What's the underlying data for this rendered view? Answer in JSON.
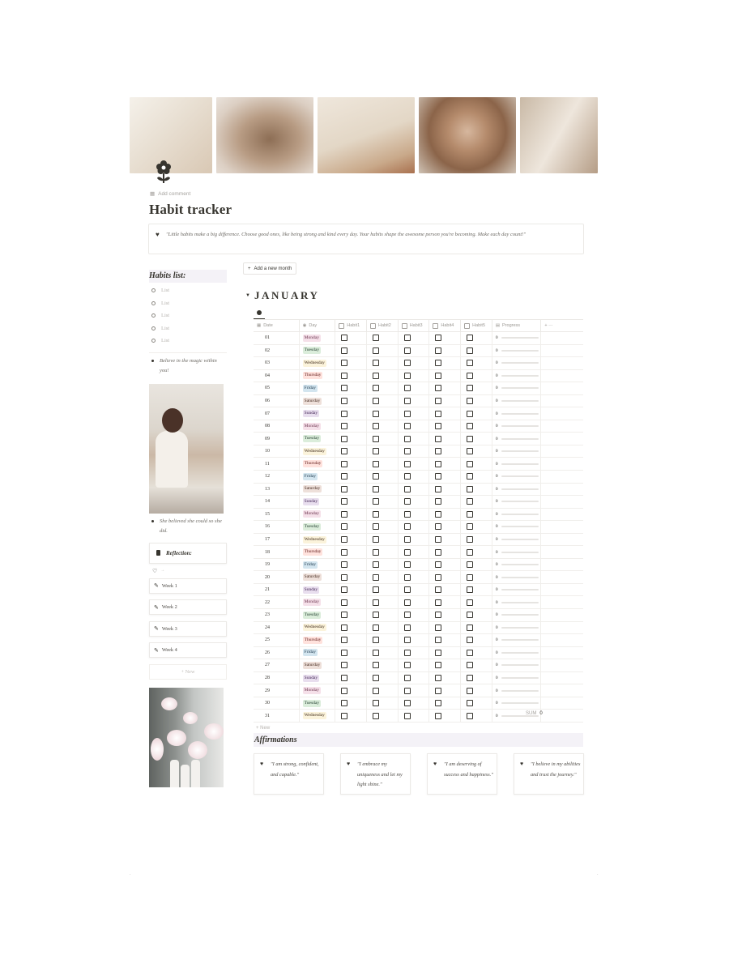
{
  "page": {
    "title": "Habit tracker",
    "add_comment": "Add comment",
    "quote": "\"Little habits make a big difference. Choose good ones, like being strong and kind every day. Your habits shape the awesome person you're becoming. Make each day count!\""
  },
  "sidebar": {
    "habits_heading": "Habits list:",
    "list_items": [
      "List",
      "List",
      "List",
      "List",
      "List"
    ],
    "quote1": "Believe in the magic within you!",
    "quote2": "She believed she could so she did.",
    "reflection_label": "Reflection:",
    "heart_row": "♥ →",
    "weeks": [
      "Week 1",
      "Week 2",
      "Week 3",
      "Week 4"
    ],
    "new_label": "+ New"
  },
  "month": {
    "add_month_label": "Add a new month",
    "name": "JANUARY"
  },
  "table": {
    "headers": {
      "date": "Date",
      "day": "Day",
      "habits": [
        "Habit1",
        "Habit2",
        "Habit3",
        "Habit4",
        "Habit5"
      ],
      "progress": "Progress",
      "add": "+  ···"
    },
    "day_colors": {
      "Monday": {
        "bg": "#f5e0e9",
        "fg": "#69314c"
      },
      "Tuesday": {
        "bg": "#dbeddb",
        "fg": "#1c3829"
      },
      "Wednesday": {
        "bg": "#fbf3db",
        "fg": "#402c1b"
      },
      "Thursday": {
        "bg": "#ffe2dd",
        "fg": "#5d1715"
      },
      "Friday": {
        "bg": "#d3e5ef",
        "fg": "#183347"
      },
      "Saturday": {
        "bg": "#eee0da",
        "fg": "#442a1e"
      },
      "Sunday": {
        "bg": "#e8deee",
        "fg": "#412454"
      }
    },
    "rows": [
      {
        "date": "01",
        "day": "Monday",
        "progress": "0"
      },
      {
        "date": "02",
        "day": "Tuesday",
        "progress": "0"
      },
      {
        "date": "03",
        "day": "Wednesday",
        "progress": "0"
      },
      {
        "date": "04",
        "day": "Thursday",
        "progress": "0"
      },
      {
        "date": "05",
        "day": "Friday",
        "progress": "0"
      },
      {
        "date": "06",
        "day": "Saturday",
        "progress": "0"
      },
      {
        "date": "07",
        "day": "Sunday",
        "progress": "0"
      },
      {
        "date": "08",
        "day": "Monday",
        "progress": "0"
      },
      {
        "date": "09",
        "day": "Tuesday",
        "progress": "0"
      },
      {
        "date": "10",
        "day": "Wednesday",
        "progress": "0"
      },
      {
        "date": "11",
        "day": "Thursday",
        "progress": "0"
      },
      {
        "date": "12",
        "day": "Friday",
        "progress": "0"
      },
      {
        "date": "13",
        "day": "Saturday",
        "progress": "0"
      },
      {
        "date": "14",
        "day": "Sunday",
        "progress": "0"
      },
      {
        "date": "15",
        "day": "Monday",
        "progress": "0"
      },
      {
        "date": "16",
        "day": "Tuesday",
        "progress": "0"
      },
      {
        "date": "17",
        "day": "Wednesday",
        "progress": "0"
      },
      {
        "date": "18",
        "day": "Thursday",
        "progress": "0"
      },
      {
        "date": "19",
        "day": "Friday",
        "progress": "0"
      },
      {
        "date": "20",
        "day": "Saturday",
        "progress": "0"
      },
      {
        "date": "21",
        "day": "Sunday",
        "progress": "0"
      },
      {
        "date": "22",
        "day": "Monday",
        "progress": "0"
      },
      {
        "date": "23",
        "day": "Tuesday",
        "progress": "0"
      },
      {
        "date": "24",
        "day": "Wednesday",
        "progress": "0"
      },
      {
        "date": "25",
        "day": "Thursday",
        "progress": "0"
      },
      {
        "date": "26",
        "day": "Friday",
        "progress": "0"
      },
      {
        "date": "27",
        "day": "Saturday",
        "progress": "0"
      },
      {
        "date": "28",
        "day": "Sunday",
        "progress": "0"
      },
      {
        "date": "29",
        "day": "Monday",
        "progress": "0"
      },
      {
        "date": "30",
        "day": "Tuesday",
        "progress": "0"
      },
      {
        "date": "31",
        "day": "Wednesday",
        "progress": "0"
      }
    ],
    "new_label": "+ New",
    "sum_label": "SUM",
    "sum_value": "0"
  },
  "affirmations": {
    "heading": "Affirmations",
    "cards": [
      "\"I am strong, confident, and capable.\"",
      "\"I embrace my uniqueness and let my light shine.\"",
      "\"I am deserving of success and happiness.\"",
      "\"I believe in my abilities and trust the journey.\""
    ]
  }
}
